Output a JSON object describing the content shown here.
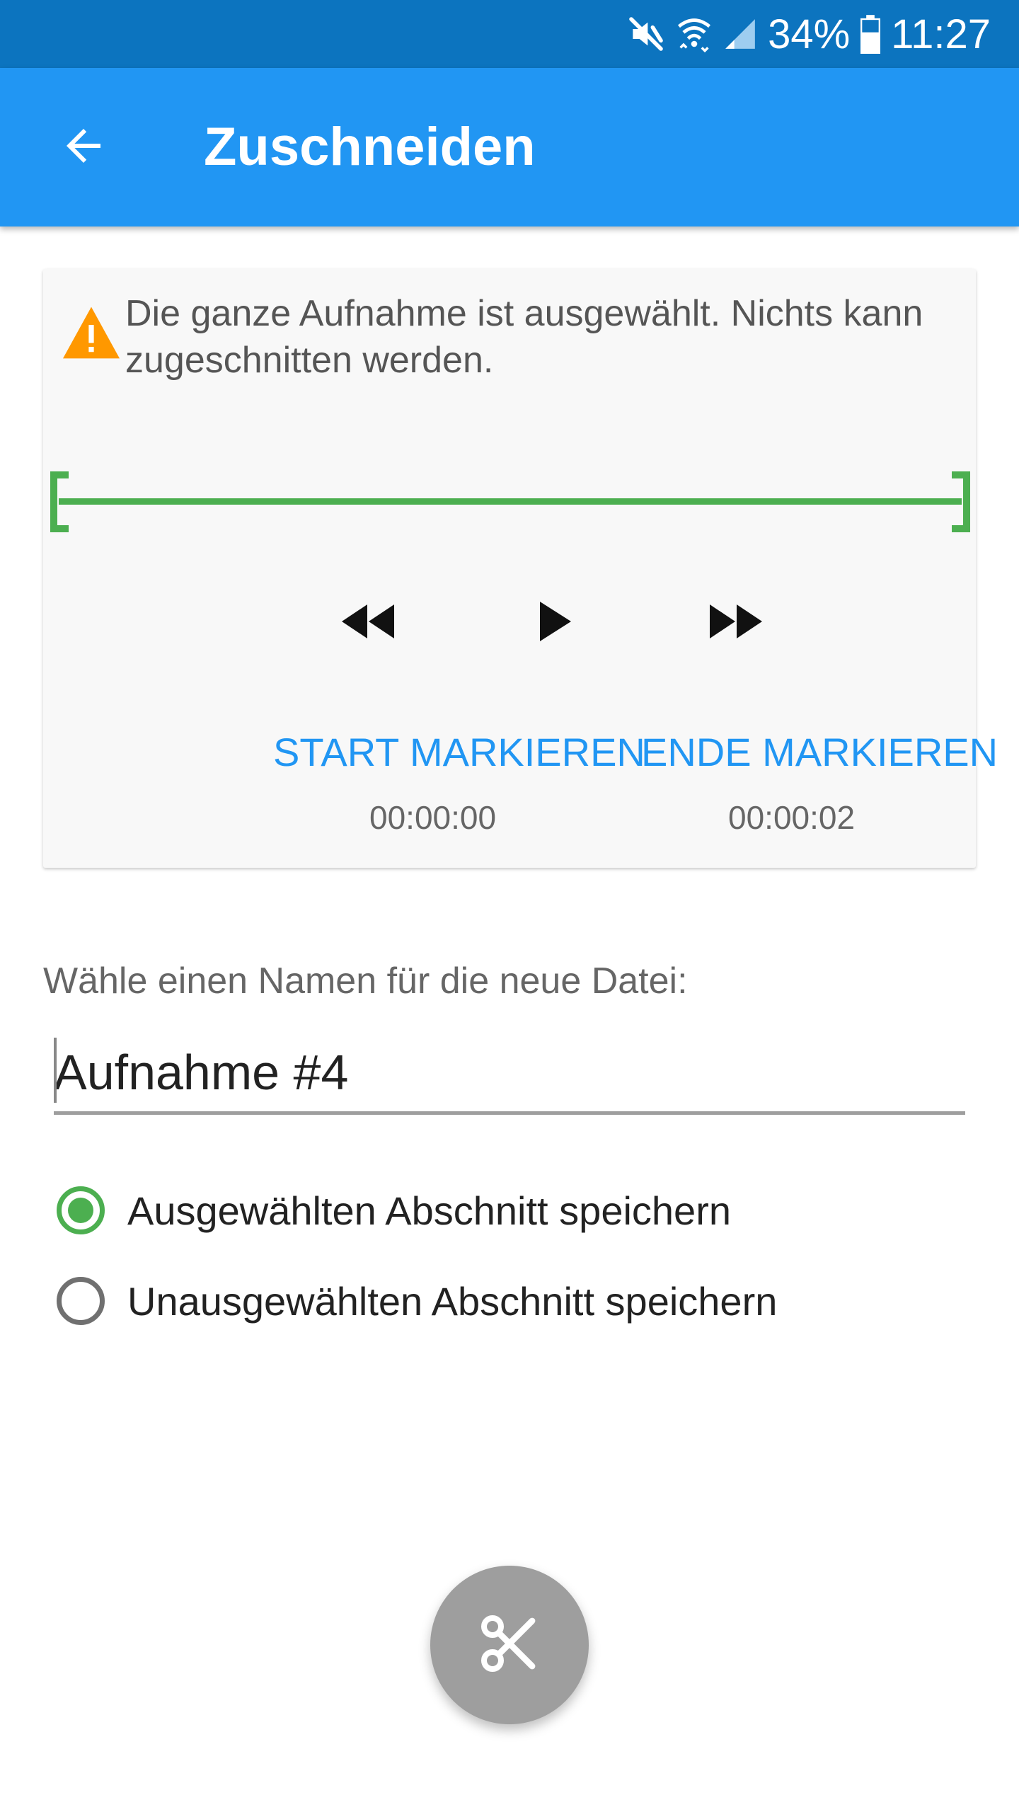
{
  "status_bar": {
    "battery": "34%",
    "time": "11:27",
    "icons": [
      "mute-icon",
      "wifi-icon",
      "signal-icon",
      "battery-icon"
    ]
  },
  "app_bar": {
    "back_icon": "arrow-back-icon",
    "title": "Zuschneiden"
  },
  "trim_card": {
    "warning_icon": "warning-icon",
    "warning_text": "Die ganze Aufnahme ist ausgewählt. Nichts kann zugeschnitten werden.",
    "selection_start_fraction": 0,
    "selection_end_fraction": 1,
    "playback": {
      "rewind_icon": "rewind-icon",
      "play_icon": "play-icon",
      "fast_forward_icon": "fast-forward-icon"
    },
    "start_marker": {
      "label": "START MARKIEREN",
      "time": "00:00:00"
    },
    "end_marker": {
      "label": "ENDE MARKIEREN",
      "time": "00:00:02"
    }
  },
  "file_name": {
    "label": "Wähle einen Namen für die neue Datei:",
    "value": "Aufnahme #4"
  },
  "save_options": [
    {
      "label": "Ausgewählten Abschnitt speichern",
      "checked": true
    },
    {
      "label": "Unausgewählten Abschnitt speichern",
      "checked": false
    }
  ],
  "fab": {
    "icon": "scissors-icon"
  },
  "colors": {
    "status_bar": "#0c74bf",
    "app_bar": "#2196f3",
    "accent": "#2196f3",
    "selection": "#4caf50",
    "warning": "#ff9800",
    "fab": "#9e9e9e"
  }
}
